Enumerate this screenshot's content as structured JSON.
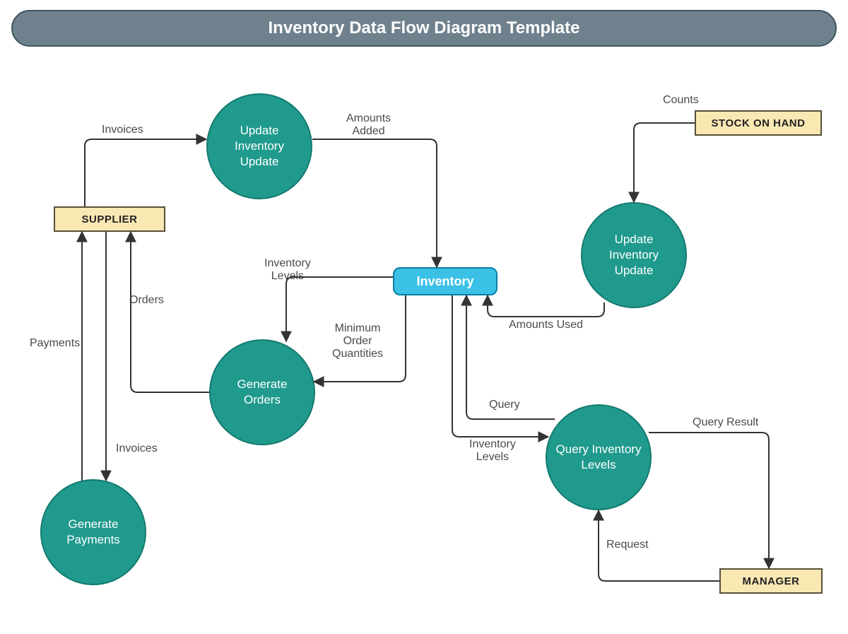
{
  "title": "Inventory Data Flow Diagram Template",
  "entities": {
    "supplier": "SUPPLIER",
    "stock_on_hand": "STOCK ON HAND",
    "manager": "MANAGER"
  },
  "processes": {
    "update_inventory_1": "Update\nInventory\nUpdate",
    "update_inventory_2": "Update\nInventory\nUpdate",
    "generate_orders": "Generate\nOrders",
    "generate_payments": "Generate\nPayments",
    "query_inventory_levels": "Query\nInventory\nLevels"
  },
  "datastores": {
    "inventory": "Inventory"
  },
  "flows": {
    "invoices_1": "Invoices",
    "amounts_added": "Amounts\nAdded",
    "counts": "Counts",
    "orders": "Orders",
    "inventory_levels_1": "Inventory\nLevels",
    "min_order_qty": "Minimum\nOrder\nQuantities",
    "amounts_used": "Amounts Used",
    "payments": "Payments",
    "invoices_2": "Invoices",
    "query": "Query",
    "inventory_levels_2": "Inventory\nLevels",
    "query_result": "Query Result",
    "request": "Request"
  },
  "diagram": {
    "type": "data_flow_diagram",
    "external_entities": [
      "SUPPLIER",
      "STOCK ON HAND",
      "MANAGER"
    ],
    "processes": [
      "Update Inventory Update",
      "Generate Orders",
      "Generate Payments",
      "Update Inventory Update",
      "Query Inventory Levels"
    ],
    "data_stores": [
      "Inventory"
    ],
    "data_flows": [
      {
        "from": "SUPPLIER",
        "to": "Update Inventory Update",
        "label": "Invoices"
      },
      {
        "from": "Update Inventory Update",
        "to": "Inventory",
        "label": "Amounts Added"
      },
      {
        "from": "STOCK ON HAND",
        "to": "Update Inventory Update",
        "label": "Counts"
      },
      {
        "from": "Update Inventory Update",
        "to": "Inventory",
        "label": "Amounts Used"
      },
      {
        "from": "Inventory",
        "to": "Generate Orders",
        "label": "Inventory Levels"
      },
      {
        "from": "Inventory",
        "to": "Generate Orders",
        "label": "Minimum Order Quantities"
      },
      {
        "from": "Generate Orders",
        "to": "SUPPLIER",
        "label": "Orders"
      },
      {
        "from": "Generate Payments",
        "to": "SUPPLIER",
        "label": "Payments"
      },
      {
        "from": "SUPPLIER",
        "to": "Generate Payments",
        "label": "Invoices"
      },
      {
        "from": "Inventory",
        "to": "Query Inventory Levels",
        "label": "Inventory Levels"
      },
      {
        "from": "Query Inventory Levels",
        "to": "Inventory",
        "label": "Query"
      },
      {
        "from": "Query Inventory Levels",
        "to": "MANAGER",
        "label": "Query Result"
      },
      {
        "from": "MANAGER",
        "to": "Query Inventory Levels",
        "label": "Request"
      }
    ]
  }
}
